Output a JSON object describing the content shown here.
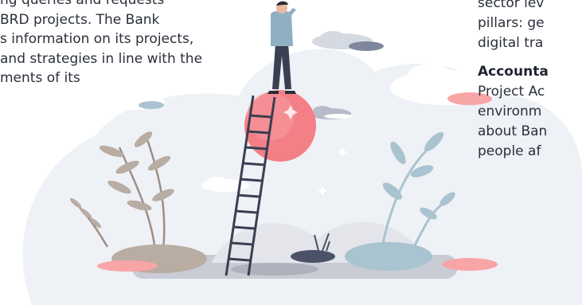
{
  "left_text": {
    "lines": [
      "ng queries and requests",
      "BRD projects. The Bank",
      "s information on its projects,",
      "and strategies in line with the",
      "ments of its"
    ]
  },
  "right_text": {
    "paragraph_lines": [
      "sector lev",
      "pillars: ge",
      "digital tra"
    ],
    "heading": "Accounta",
    "body_lines": [
      "Project Ac",
      "environm",
      "about Ban",
      "people af"
    ]
  },
  "illustration": {
    "subject": "person standing on ball atop ladder looking into distance",
    "colors": {
      "backdrop": "#eef1f5",
      "ball": "#f47f86",
      "ladder": "#3a3f52",
      "leaf_blue": "#a9c3d0",
      "leaf_brown": "#b9aca3",
      "cloud_gray": "#b7bcc8",
      "cloud_pink": "#f7a5a6"
    }
  }
}
